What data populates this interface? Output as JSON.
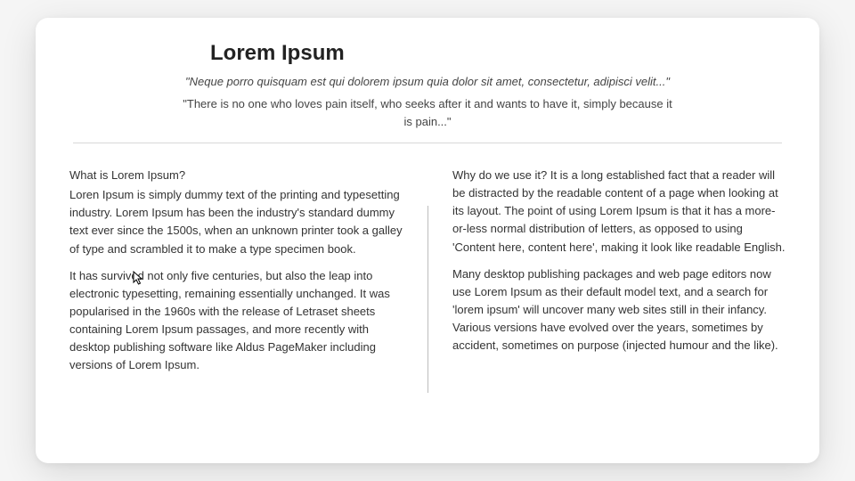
{
  "title": "Lorem Ipsum",
  "quote_latin": "\"Neque porro quisquam est qui dolorem ipsum quia dolor sit amet, consectetur, adipisci velit...\"",
  "quote_english": "\"There is no one who loves pain itself, who seeks after it and wants to have it, simply because it is pain...\"",
  "left": {
    "heading": "What is Lorem Ipsum?",
    "p1": "Loren Ipsum is simply dummy text of the printing and typesetting industry. Lorem Ipsum has been the industry's standard dummy text ever since the 1500s, when an unknown printer took a galley of type and scrambled it to make a type specimen book.",
    "p2": "It has survived not only five centuries, but also the leap into electronic typesetting, remaining essentially unchanged. It was popularised in the 1960s with the release of Letraset sheets containing Lorem Ipsum passages, and more recently with desktop publishing software like Aldus PageMaker including versions of Lorem Ipsum."
  },
  "right": {
    "p1": "Why do we use it? It is a long established fact that a reader will be distracted by the readable content of a page when looking at its layout. The point of using Lorem Ipsum is that it has a more-or-less normal distribution of letters, as opposed to using 'Content here, content here', making it look like readable English.",
    "p2": " Many desktop publishing packages and web page editors now use Lorem Ipsum as their default model text, and a search for 'lorem ipsum' will uncover many web sites still in their infancy. Various versions have evolved over the years, sometimes by accident, sometimes on purpose (injected humour and the like)."
  }
}
